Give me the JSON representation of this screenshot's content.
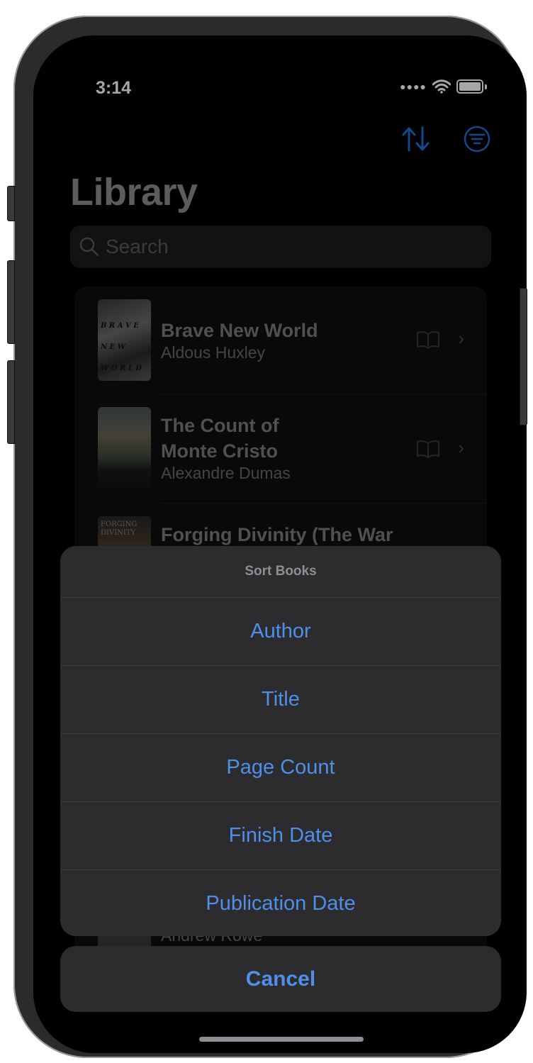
{
  "status_bar": {
    "time": "3:14"
  },
  "nav": {
    "sort_icon": "arrow-up-arrow-down-icon",
    "filter_icon": "line-3-horizontal-decrease-circle-icon"
  },
  "page_title": "Library",
  "search": {
    "placeholder": "Search"
  },
  "books": [
    {
      "title": "Brave New World",
      "author": "Aldous Huxley"
    },
    {
      "title": "The Count of\nMonte Cristo",
      "author": "Alexandre Dumas"
    },
    {
      "title": "Forging Divinity (The War",
      "author": ""
    },
    {
      "title": "",
      "author": "Andrew Rowe"
    }
  ],
  "action_sheet": {
    "title": "Sort Books",
    "options": [
      "Author",
      "Title",
      "Page Count",
      "Finish Date",
      "Publication Date"
    ],
    "cancel_label": "Cancel"
  },
  "colors": {
    "accent": "#4f8fe8",
    "background": "#000000",
    "sheet": "#2c2c2e"
  }
}
